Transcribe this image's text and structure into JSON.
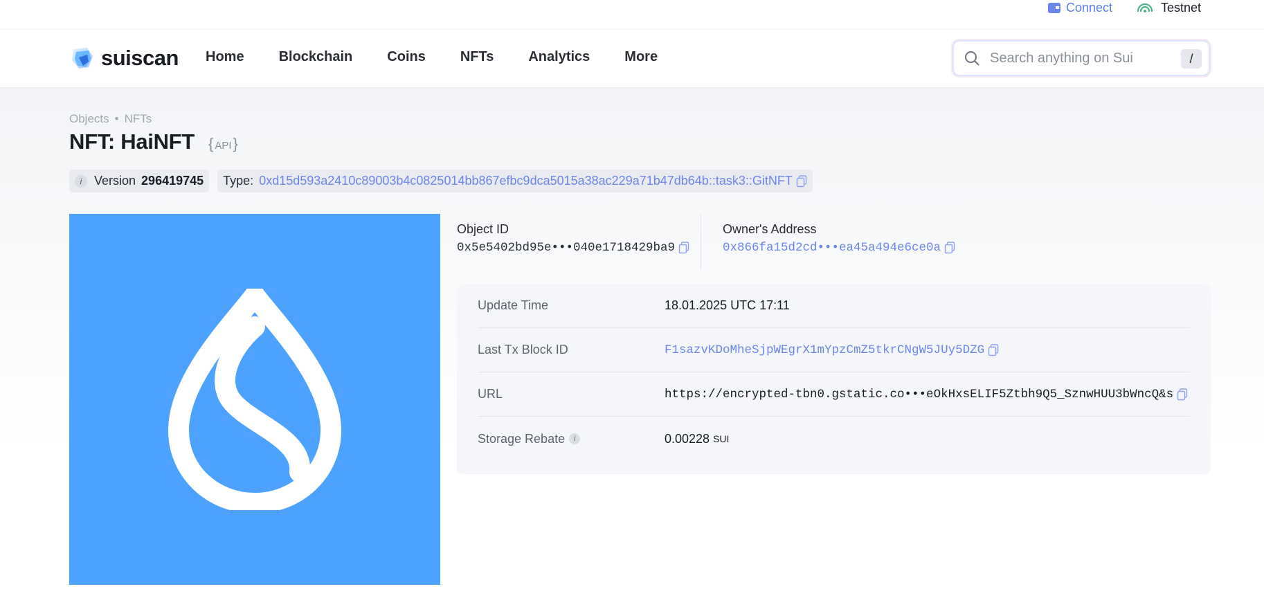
{
  "topbar": {
    "connect_label": "Connect",
    "network_label": "Testnet"
  },
  "header": {
    "logo_text": "suiscan",
    "nav": [
      "Home",
      "Blockchain",
      "Coins",
      "NFTs",
      "Analytics",
      "More"
    ],
    "search_placeholder": "Search anything on Sui",
    "search_shortcut": "/"
  },
  "breadcrumb": [
    "Objects",
    "NFTs"
  ],
  "page": {
    "title": "NFT: HaiNFT",
    "api_label": "API"
  },
  "meta": {
    "info_glyph": "i",
    "version_label": "Version",
    "version_value": "296419745",
    "type_label": "Type:",
    "type_value": "0xd15d593a2410c89003b4c0825014bb867efbc9dca5015a38ac229a71b47db64b::task3::GitNFT"
  },
  "object": {
    "object_id_label": "Object ID",
    "object_id_value": "0x5e5402bd95e•••040e1718429ba9",
    "owner_label": "Owner's Address",
    "owner_value": "0x866fa15d2cd•••ea45a494e6ce0a"
  },
  "details": [
    {
      "label": "Update Time",
      "value": "18.01.2025 UTC 17:11"
    },
    {
      "label": "Last Tx Block ID",
      "value": "F1sazvKDoMheSjpWEgrX1mYpzCmZ5tkrCNgW5JUy5DZG"
    },
    {
      "label": "URL",
      "value": "https://encrypted-tbn0.gstatic.co•••eOkHxsELIF5Ztbh9Q5_SznwHUU3bWncQ&s"
    },
    {
      "label": "Storage Rebate",
      "value": "0.00228",
      "unit": "SUI"
    }
  ],
  "colors": {
    "accent": "#6b86e8",
    "nft_background": "#4da2ff"
  }
}
